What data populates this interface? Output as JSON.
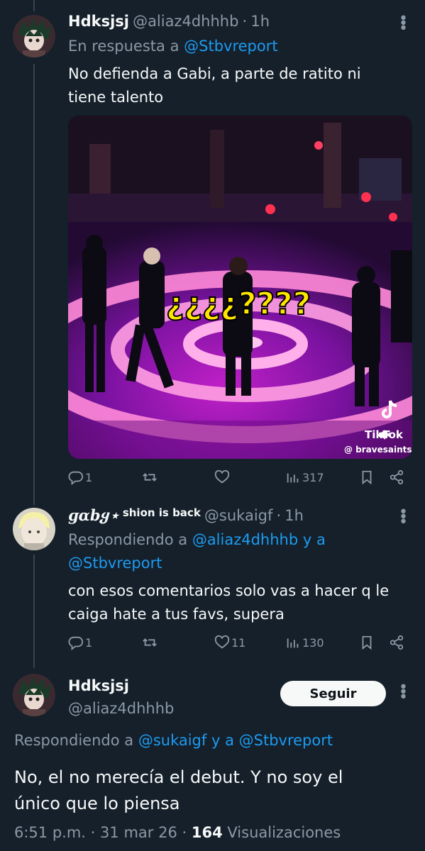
{
  "tweet1": {
    "name": "Hdksjsj",
    "handle": "@aliaz4dhhhb",
    "sep": "·",
    "time": "1h",
    "reply_prefix": "En respuesta a",
    "reply_handle": "@Stbvreport",
    "text_line1": "No defienda a Gabi, a parte de ratito ni",
    "text_line2": "tiene talento",
    "media": {
      "caption": "¿¿¿¿????",
      "tiktok_label": "TikTok",
      "tiktok_user": "@ bravesaints"
    },
    "stats": {
      "replies": "1",
      "retweets": "",
      "likes": "",
      "views": "317"
    }
  },
  "tweet2": {
    "name": "ɡɑbყ⋆",
    "name_extra": "shion is back",
    "handle": "@sukaigf",
    "sep": "·",
    "time": "1h",
    "reply_prefix": "Respondiendo a",
    "reply_handle1": "@aliaz4dhhhb",
    "reply_and": "y a",
    "reply_handle2": "@Stbvreport",
    "text_line1": "con esos comentarios solo vas a hacer q le",
    "text_line2": "caiga hate a tus favs, supera",
    "stats": {
      "replies": "1",
      "retweets": "",
      "likes": "11",
      "views": "130"
    }
  },
  "tweet3": {
    "name": "Hdksjsj",
    "handle": "@aliaz4dhhhb",
    "follow_label": "Seguir",
    "reply_prefix": "Respondiendo a",
    "reply_handle1": "@sukaigf",
    "reply_and": "y a",
    "reply_handle2": "@Stbvreport",
    "text_line1": "No, el no merecía el debut. Y no soy el",
    "text_line2": "único que lo piensa",
    "time": "6:51 p.m.",
    "sep": "·",
    "date": "31 mar 26",
    "views_count": "164",
    "views_label": "Visualizaciones"
  },
  "colors": {
    "background": "#15202b",
    "accent": "#1d9bf0",
    "muted": "#8b98a5",
    "text": "#f7f9f9"
  },
  "icons": [
    "more-icon",
    "reply-icon",
    "retweet-icon",
    "like-icon",
    "views-icon",
    "bookmark-icon",
    "share-icon",
    "tiktok-logo-icon",
    "speaker-icon"
  ]
}
